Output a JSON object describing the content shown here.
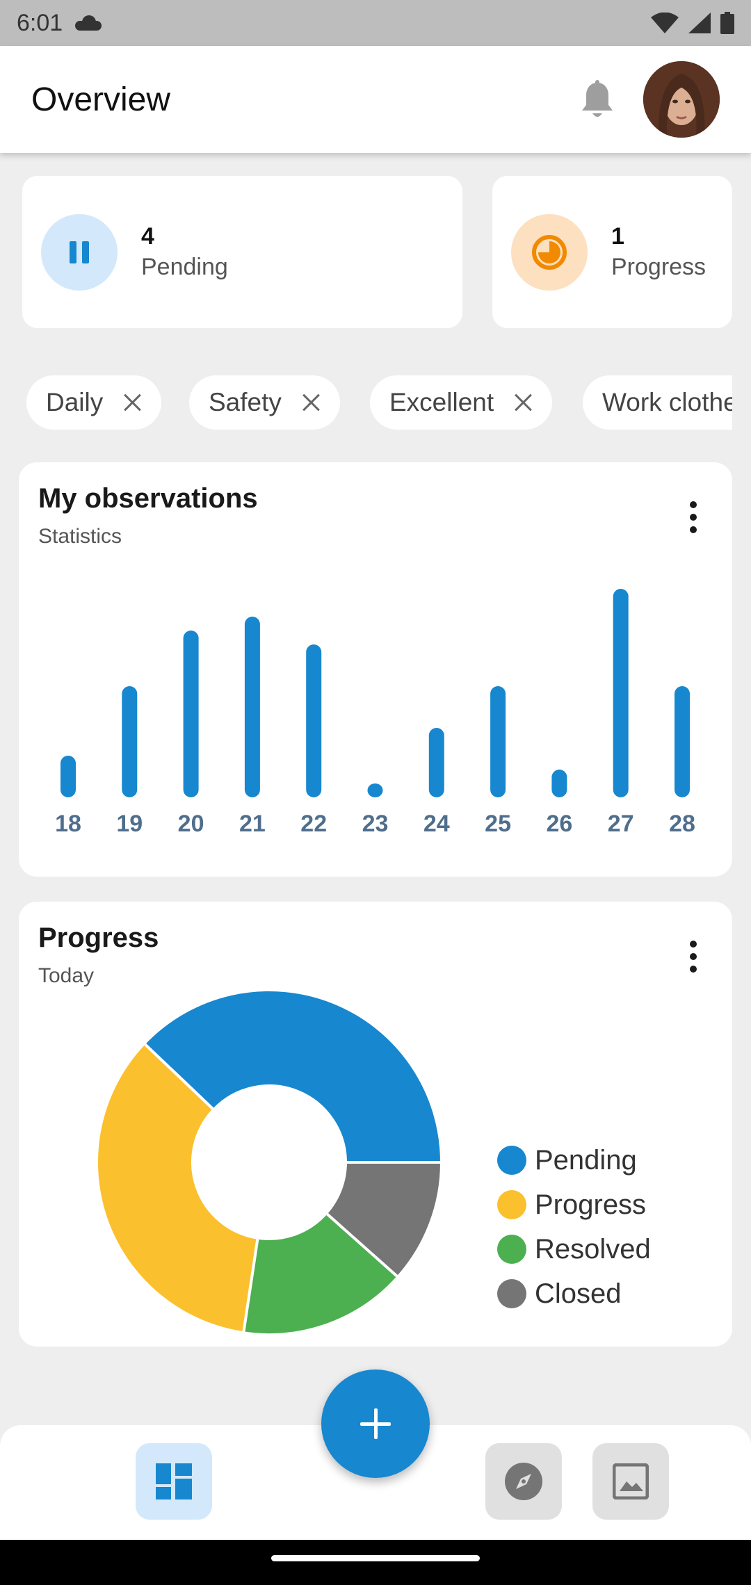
{
  "status_bar": {
    "time": "6:01"
  },
  "header": {
    "title": "Overview"
  },
  "stats": [
    {
      "count": "4",
      "label": "Pending",
      "color": "#1787cf",
      "bg": "#d3e9fb"
    },
    {
      "count": "1",
      "label": "Progress",
      "color": "#f18a00",
      "bg": "#fde0bf"
    }
  ],
  "filters": [
    {
      "label": "Daily"
    },
    {
      "label": "Safety"
    },
    {
      "label": "Excellent"
    },
    {
      "label": "Work clothe"
    }
  ],
  "observations_card": {
    "title": "My observations",
    "subtitle": "Statistics"
  },
  "progress_card": {
    "title": "Progress",
    "subtitle": "Today"
  },
  "chart_data": [
    {
      "type": "bar",
      "title": "My observations",
      "subtitle": "Statistics",
      "categories": [
        "18",
        "19",
        "20",
        "21",
        "22",
        "23",
        "24",
        "25",
        "26",
        "27",
        "28"
      ],
      "values": [
        3,
        8,
        12,
        13,
        11,
        1,
        5,
        8,
        2,
        15,
        8
      ],
      "color": "#1787cf",
      "grid": false
    },
    {
      "type": "pie",
      "title": "Progress",
      "subtitle": "Today",
      "labels": [
        "Pending",
        "Progress",
        "Resolved",
        "Closed"
      ],
      "values": [
        36,
        33,
        15,
        11
      ],
      "colors": [
        "#1787cf",
        "#fbc02d",
        "#4caf50",
        "#757575"
      ],
      "legend_position": "right",
      "donut": true
    }
  ],
  "nav": [
    {
      "icon": "dashboard-icon",
      "active": true
    },
    {
      "icon": "explore-icon",
      "active": false
    },
    {
      "icon": "image-icon",
      "active": false
    }
  ],
  "fab": {
    "icon": "plus-icon"
  }
}
